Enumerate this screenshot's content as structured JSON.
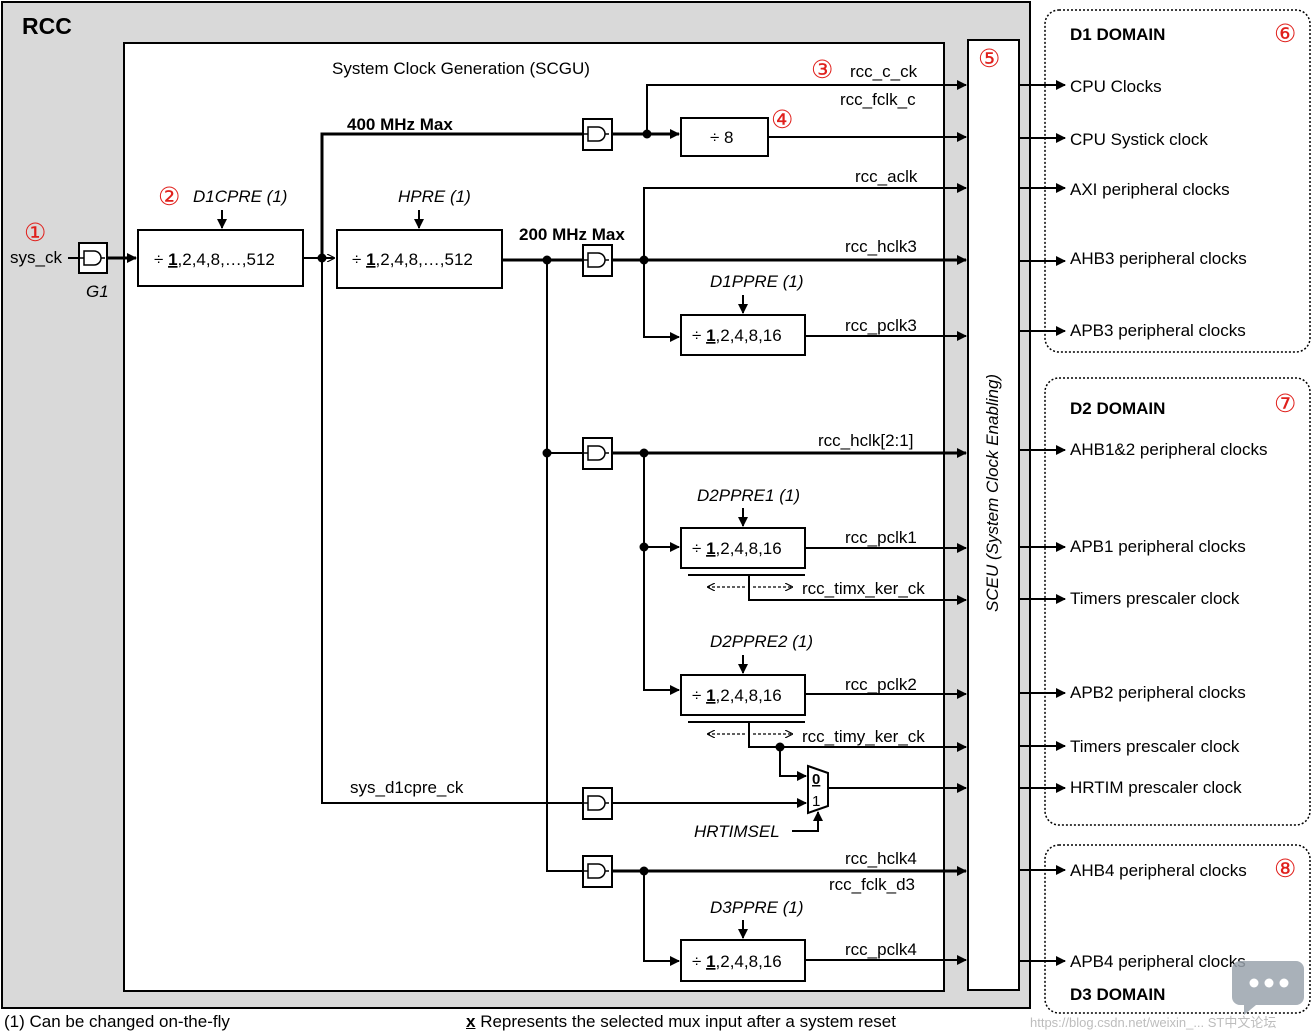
{
  "rcc_label": "RCC",
  "scgu_title": "System Clock Generation (SCGU)",
  "sceu_label": "SCEU (System Clock Enabling)",
  "input_signal": "sys_ck",
  "gate_label": "G1",
  "markers": [
    "①",
    "②",
    "③",
    "④",
    "⑤",
    "⑥",
    "⑦",
    "⑧"
  ],
  "max_labels": {
    "max400": "400 MHz Max",
    "max200": "200 MHz Max"
  },
  "prescalers": {
    "d1cpre": {
      "name": "D1CPRE (1)",
      "pre": "÷ ",
      "bold": "1",
      "post": ",2,4,8,…,512"
    },
    "hpre": {
      "name": "HPRE (1)",
      "pre": "÷ ",
      "bold": "1",
      "post": ",2,4,8,…,512"
    },
    "div8": {
      "text": "÷ 8"
    },
    "d1ppre": {
      "name": "D1PPRE (1)",
      "pre": "÷ ",
      "bold": "1",
      "post": ",2,4,8,16"
    },
    "d2ppre1": {
      "name": "D2PPRE1 (1)",
      "pre": "÷ ",
      "bold": "1",
      "post": ",2,4,8,16"
    },
    "d2ppre2": {
      "name": "D2PPRE2 (1)",
      "pre": "÷ ",
      "bold": "1",
      "post": ",2,4,8,16"
    },
    "d3ppre": {
      "name": "D3PPRE (1)",
      "pre": "÷ ",
      "bold": "1",
      "post": ",2,4,8,16"
    }
  },
  "signals": {
    "rcc_c_ck": "rcc_c_ck",
    "rcc_fclk_c": "rcc_fclk_c",
    "rcc_aclk": "rcc_aclk",
    "rcc_hclk3": "rcc_hclk3",
    "rcc_pclk3": "rcc_pclk3",
    "rcc_hclk21": "rcc_hclk[2:1]",
    "rcc_pclk1": "rcc_pclk1",
    "rcc_timx_ker_ck": "rcc_timx_ker_ck",
    "rcc_pclk2": "rcc_pclk2",
    "rcc_timy_ker_ck": "rcc_timy_ker_ck",
    "sys_d1cpre_ck": "sys_d1cpre_ck",
    "hrtimsel": "HRTIMSEL",
    "rcc_hclk4": "rcc_hclk4",
    "rcc_fclk_d3": "rcc_fclk_d3",
    "rcc_pclk4": "rcc_pclk4"
  },
  "mux_inputs": {
    "in0": "0",
    "in1": "1"
  },
  "domains": {
    "d1": {
      "title": "D1 DOMAIN",
      "outputs": [
        "CPU Clocks",
        "CPU Systick clock",
        "AXI peripheral clocks",
        "AHB3 peripheral clocks",
        "APB3 peripheral clocks"
      ]
    },
    "d2": {
      "title": "D2 DOMAIN",
      "outputs": [
        "AHB1&2 peripheral clocks",
        "APB1 peripheral clocks",
        "Timers prescaler clock",
        "APB2 peripheral clocks",
        "Timers prescaler clock",
        "HRTIM prescaler clock"
      ]
    },
    "d3": {
      "title": "D3 DOMAIN",
      "outputs": [
        "AHB4 peripheral clocks",
        "APB4 peripheral clocks"
      ]
    }
  },
  "footnotes": {
    "left": "(1) Can be changed on-the-fly",
    "right_bold": "x",
    "right": " Represents the selected mux input after a system reset"
  },
  "watermark": "https://blog.csdn.net/weixin_... ST中文论坛",
  "colors": {
    "marker": "#e0201c",
    "rcc_bg": "#d9d9d9",
    "line": "#000000"
  }
}
